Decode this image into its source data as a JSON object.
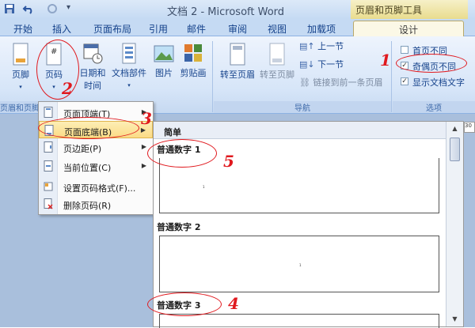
{
  "title": "文档 2 - Microsoft Word",
  "context_tab_group": "页眉和页脚工具",
  "tabs": [
    "开始",
    "插入",
    "页面布局",
    "引用",
    "邮件",
    "审阅",
    "视图",
    "加载项",
    "设计"
  ],
  "ribbon": {
    "footer": "页脚",
    "page_number": "页码",
    "date_time_line1": "日期和",
    "date_time_line2": "时间",
    "doc_parts": "文档部件",
    "picture": "图片",
    "clipart": "剪贴画",
    "goto_header": "转至页眉",
    "goto_footer": "转至页脚",
    "prev_section": "上一节",
    "next_section": "下一节",
    "link_previous": "链接到前一条页眉",
    "group_header_footer": "页眉和页脚",
    "group_nav": "导航",
    "group_options": "选项",
    "opt_first_page": "首页不同",
    "opt_odd_even": "奇偶页不同",
    "opt_show_text": "显示文档文字"
  },
  "options_checked": [
    false,
    true,
    true
  ],
  "menu": {
    "items": [
      {
        "label": "页面顶端(T)",
        "arrow": true
      },
      {
        "label": "页面底端(B)",
        "arrow": true
      },
      {
        "label": "页边距(P)",
        "arrow": true
      },
      {
        "label": "当前位置(C)",
        "arrow": true
      },
      {
        "label": "设置页码格式(F)...",
        "arrow": false
      },
      {
        "label": "删除页码(R)",
        "arrow": false
      }
    ]
  },
  "gallery": {
    "header": "简单",
    "items": [
      "普通数字 1",
      "普通数字 2",
      "普通数字 3"
    ],
    "page_number_glyph": "1"
  },
  "ruler_text": "30",
  "annotations": [
    "1",
    "2",
    "3",
    "4",
    "5"
  ],
  "colors": {
    "annotation": "#e0191e",
    "ribbon": "#d6e5f8",
    "highlight": "#fbdb86"
  }
}
